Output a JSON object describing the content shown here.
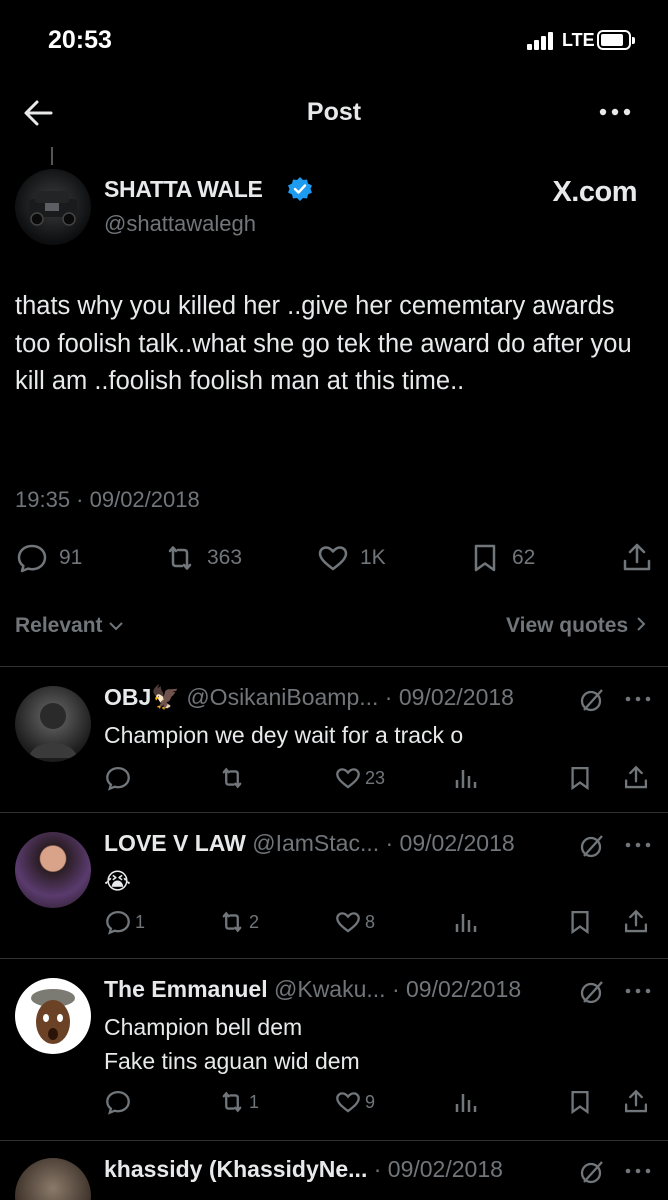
{
  "status_bar": {
    "time": "20:53",
    "network": "LTE"
  },
  "header": {
    "title": "Post"
  },
  "post": {
    "author_name": "SHATTA WALE",
    "author_handle": "@shattawalegh",
    "watermark": "X.com",
    "text": "thats why you killed her ..give her cememtary awards too foolish talk..what she go tek the award do after you kill am ..foolish foolish man at this time..",
    "timestamp": "19:35 · 09/02/2018",
    "replies": "91",
    "reposts": "363",
    "likes": "1K",
    "bookmarks": "62"
  },
  "sort": {
    "relevant_label": "Relevant",
    "view_quotes_label": "View quotes"
  },
  "replies": [
    {
      "name": "OBJ",
      "handle_date": "@OsikaniBoamp... · 09/02/2018",
      "text": "Champion we dey wait for a track o",
      "replies": "",
      "reposts": "",
      "likes": "23"
    },
    {
      "name": "LOVE V LAW",
      "handle_date": "@IamStac... · 09/02/2018",
      "text": "😭",
      "replies": "1",
      "reposts": "2",
      "likes": "8"
    },
    {
      "name": "The Emmanuel",
      "handle_date": "@Kwaku... · 09/02/2018",
      "text": "Champion bell dem\nFake tins aguan wid dem",
      "replies": "",
      "reposts": "1",
      "likes": "9"
    },
    {
      "name": "khassidy (KhassidyNe...",
      "handle_date": "· 09/02/2018",
      "text": "",
      "replies": "",
      "reposts": "",
      "likes": ""
    }
  ],
  "colors": {
    "background": "#000000",
    "text": "#e7e9ea",
    "muted": "#71767b",
    "verified": "#1d9bf0",
    "divider": "#2f3336"
  }
}
